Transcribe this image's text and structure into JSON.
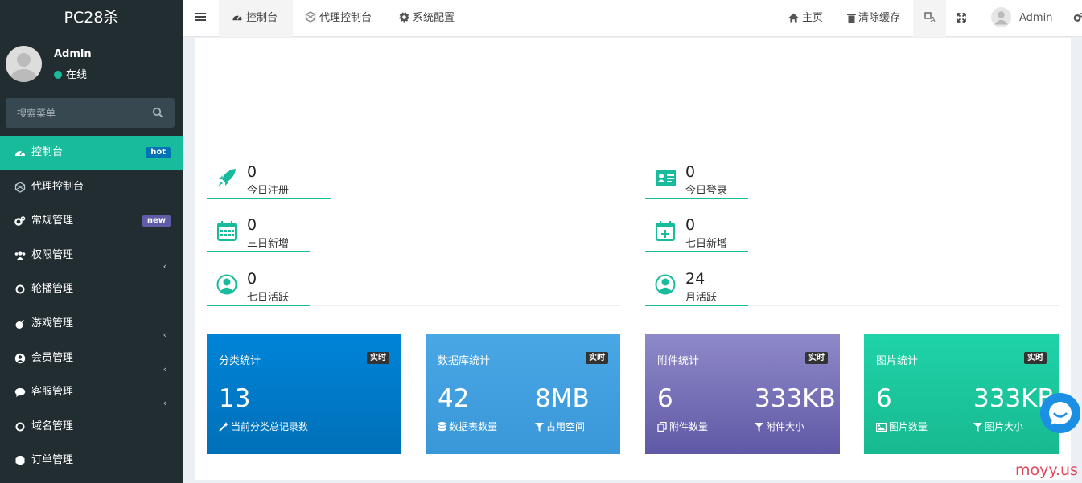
{
  "brand": "PC28杀",
  "user": {
    "name": "Admin",
    "status": "在线"
  },
  "search": {
    "placeholder": "搜索菜单"
  },
  "menu": [
    {
      "label": "控制台",
      "icon": "dashboard-icon",
      "badge": "hot",
      "badge_color": "#0073b7"
    },
    {
      "label": "代理控制台",
      "icon": "hexagon-outline-icon"
    },
    {
      "label": "常规管理",
      "icon": "cogs-icon",
      "badge": "new",
      "badge_color": "#605ca8"
    },
    {
      "label": "权限管理",
      "icon": "group-icon",
      "chevron": "‹"
    },
    {
      "label": "轮播管理",
      "icon": "circle-outline-icon"
    },
    {
      "label": "游戏管理",
      "icon": "bomb-icon",
      "chevron": "‹"
    },
    {
      "label": "会员管理",
      "icon": "user-circle-icon",
      "chevron": "‹"
    },
    {
      "label": "客服管理",
      "icon": "comment-icon",
      "chevron": "‹"
    },
    {
      "label": "域名管理",
      "icon": "circle-outline-icon"
    },
    {
      "label": "订单管理",
      "icon": "cube-icon"
    }
  ],
  "navbar": {
    "tabs": [
      {
        "label": "控制台",
        "icon": "dashboard-icon"
      },
      {
        "label": "代理控制台",
        "icon": "hexagon-outline-icon"
      },
      {
        "label": "系统配置",
        "icon": "gear-icon"
      }
    ],
    "right": {
      "home": "主页",
      "clear_cache": "清除缓存",
      "admin": "Admin"
    }
  },
  "stats": [
    {
      "value": "0",
      "label": "今日注册",
      "icon": "rocket-icon"
    },
    {
      "value": "0",
      "label": "今日登录",
      "icon": "id-card-icon"
    },
    {
      "value": "0",
      "label": "三日新增",
      "icon": "calendar-icon"
    },
    {
      "value": "0",
      "label": "七日新增",
      "icon": "calendar-plus-icon"
    },
    {
      "value": "0",
      "label": "七日活跃",
      "icon": "user-circle-outline-icon"
    },
    {
      "value": "24",
      "label": "月活跃",
      "icon": "user-circle-outline-icon"
    }
  ],
  "cards": [
    {
      "title": "分类统计",
      "tag": "实时",
      "left_value": "13",
      "left_label": "当前分类总记录数",
      "left_icon": "magic-icon",
      "color_top": "#0084d8",
      "color_bottom": "#0070b8"
    },
    {
      "title": "数据库统计",
      "tag": "实时",
      "left_value": "42",
      "left_label": "数据表数量",
      "left_icon": "database-icon",
      "right_value": "8MB",
      "right_label": "占用空间",
      "right_icon": "filter-icon",
      "color_top": "#4aa7e6",
      "color_bottom": "#3a97d8"
    },
    {
      "title": "附件统计",
      "tag": "实时",
      "left_value": "6",
      "left_label": "附件数量",
      "left_icon": "files-icon",
      "right_value": "333KB",
      "right_label": "附件大小",
      "right_icon": "filter-icon",
      "color_top": "#8f8ac9",
      "color_bottom": "#5f59a6"
    },
    {
      "title": "图片统计",
      "tag": "实时",
      "left_value": "6",
      "left_label": "图片数量",
      "left_icon": "image-icon",
      "right_value": "333KB",
      "right_label": "图片大小",
      "right_icon": "filter-icon",
      "color_top": "#1fd3a9",
      "color_bottom": "#18b990"
    }
  ],
  "watermark": "moyy.us"
}
